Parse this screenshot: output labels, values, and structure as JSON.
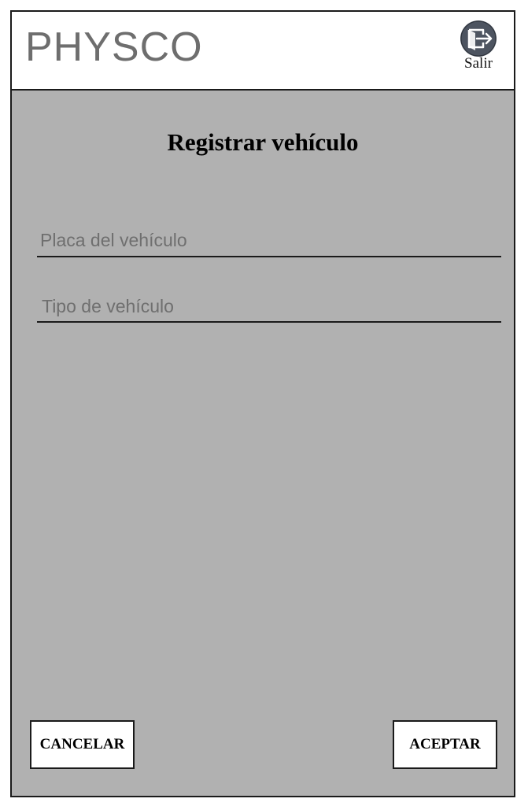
{
  "header": {
    "app_title": "PHYSCO",
    "logout_label": "Salir",
    "logout_icon": "logout-icon"
  },
  "form": {
    "title": "Registrar vehículo",
    "plate_placeholder": "Placa del vehículo",
    "plate_value": "",
    "type_placeholder": "Tipo de vehículo",
    "type_value": ""
  },
  "actions": {
    "cancel_label": "CANCELAR",
    "accept_label": "ACEPTAR"
  },
  "colors": {
    "background": "#b1b1b1",
    "header_bg": "#ffffff",
    "title_text": "#6e6e6e",
    "icon_circle": "#4d5460"
  }
}
